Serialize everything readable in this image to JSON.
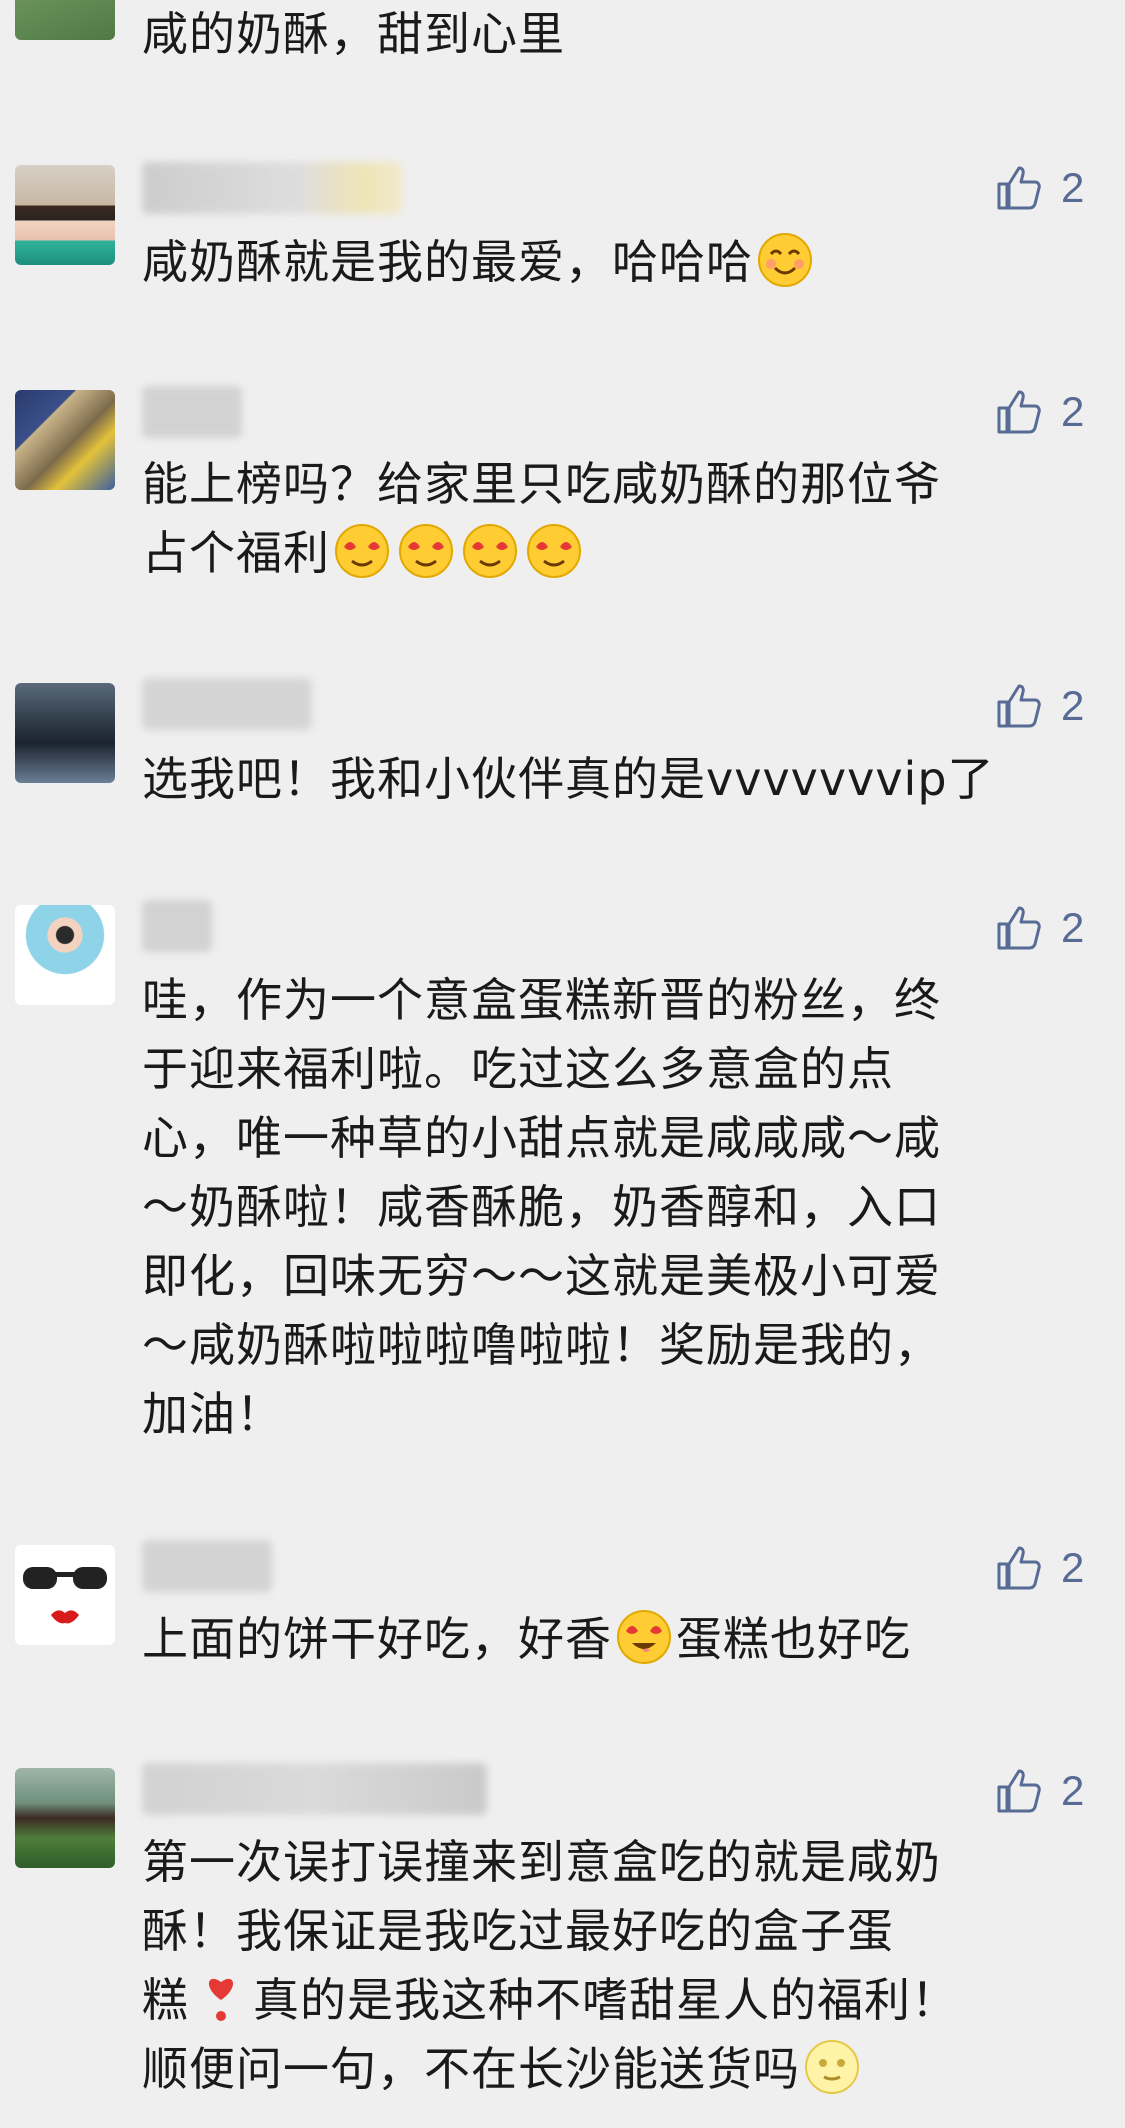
{
  "comments": [
    {
      "text": "咸的奶酥，甜到心里",
      "avatar_icon": "avatar-green-photo"
    },
    {
      "text": "咸奶酥就是我的最爱，哈哈哈",
      "text_emoji": "smiling-face-emoji",
      "likes": "2",
      "avatar_icon": "avatar-woman-portrait"
    },
    {
      "line1": "能上榜吗？给家里只吃咸奶酥的那位爷",
      "line2": "占个福利",
      "emojis": [
        "heart-eyes-emoji",
        "heart-eyes-emoji",
        "heart-eyes-emoji",
        "heart-eyes-emoji"
      ],
      "likes": "2",
      "avatar_icon": "avatar-person-sitting"
    },
    {
      "text": "选我吧！我和小伙伴真的是vvvvvvvip了",
      "likes": "2",
      "avatar_icon": "avatar-people-indoors"
    },
    {
      "lines": [
        "哇，作为一个意盒蛋糕新晋的粉丝，终",
        "于迎来福利啦。吃过这么多意盒的点",
        "心，唯一种草的小甜点就是咸咸咸～咸",
        "～奶酥啦！咸香酥脆，奶香醇和，入口",
        "即化，回味无穷～～这就是美极小可爱",
        "～咸奶酥啦啦啦噜啦啦！奖励是我的，",
        "加油！"
      ],
      "likes": "2",
      "avatar_icon": "avatar-cartoon-girl"
    },
    {
      "text_before": "上面的饼干好吃，好香",
      "text_emoji": "drooling-heart-eyes-emoji",
      "text_after": "蛋糕也好吃",
      "likes": "2",
      "avatar_icon": "avatar-sunglasses-lips"
    },
    {
      "line1": "第一次误打误撞来到意盒吃的就是咸奶",
      "line2": "酥！我保证是我吃过最好吃的盒子蛋",
      "line3_before": "糕",
      "line3_emoji": "red-heart-exclamation-emoji",
      "line3_after": "真的是我这种不嗜甜星人的福利！",
      "line4": "顺便问一句，不在长沙能送货吗",
      "line4_emoji": "full-moon-face-emoji",
      "likes": "2",
      "avatar_icon": "avatar-girl-grass"
    }
  ],
  "colors": {
    "background": "#efefef",
    "link_blue": "#576b95",
    "text": "#1a1a1a"
  }
}
